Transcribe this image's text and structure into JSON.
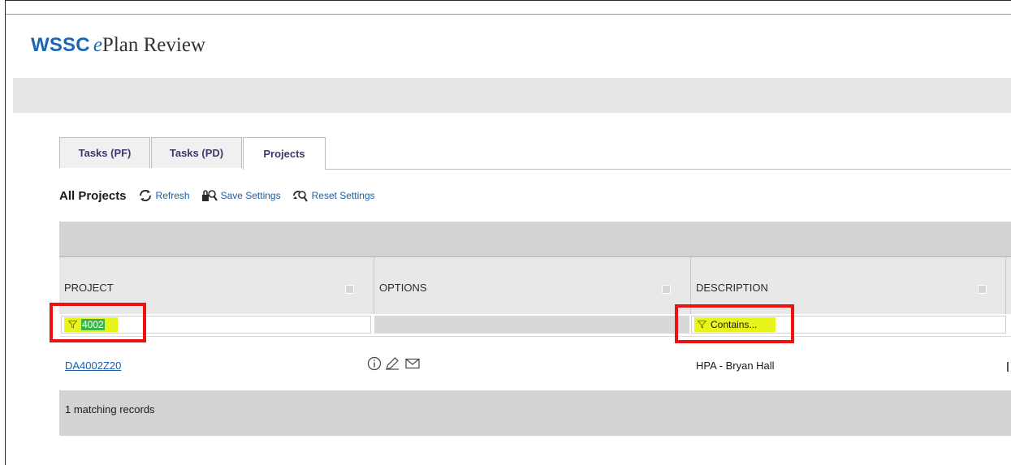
{
  "app": {
    "logo_brand": "WSSC",
    "logo_e": "e",
    "logo_rest": "Plan Review"
  },
  "tabs": [
    {
      "label": "Tasks (PF)",
      "active": false
    },
    {
      "label": "Tasks (PD)",
      "active": false
    },
    {
      "label": "Projects",
      "active": true
    }
  ],
  "toolbar": {
    "title": "All Projects",
    "refresh_label": "Refresh",
    "save_label": "Save Settings",
    "reset_label": "Reset Settings"
  },
  "grid": {
    "columns": [
      "PROJECT",
      "OPTIONS",
      "DESCRIPTION"
    ],
    "filters": {
      "project_value": "4002",
      "description_placeholder": "Contains..."
    },
    "rows": [
      {
        "project": "DA4002Z20",
        "options_icons": [
          "info-icon",
          "edit-icon",
          "mail-icon"
        ],
        "description": "HPA - Bryan Hall"
      }
    ],
    "footer": "1 matching records"
  },
  "colors": {
    "brand_blue": "#1b67b3",
    "link_blue": "#1b5ea8",
    "highlight_yellow": "#e8f51a",
    "annotation_red": "#ee1111",
    "grid_grey": "#d3d3d3"
  }
}
